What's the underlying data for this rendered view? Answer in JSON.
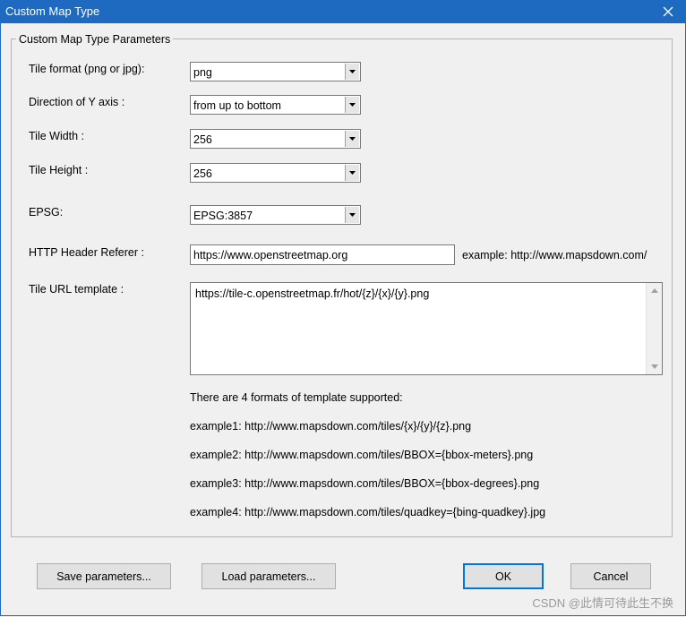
{
  "window": {
    "title": "Custom Map Type",
    "close_icon": "close-icon"
  },
  "group": {
    "legend": "Custom Map Type Parameters"
  },
  "fields": {
    "tile_format": {
      "label": "Tile format (png or jpg):",
      "value": "png"
    },
    "y_direction": {
      "label": "Direction of Y axis :",
      "value": "from up to bottom"
    },
    "tile_width": {
      "label": "Tile Width :",
      "value": "256"
    },
    "tile_height": {
      "label": "Tile Height :",
      "value": "256"
    },
    "epsg": {
      "label": "EPSG:",
      "value": "EPSG:3857"
    },
    "referer": {
      "label": "HTTP Header Referer :",
      "value": "https://www.openstreetmap.org",
      "example": "example: http://www.mapsdown.com/"
    },
    "url_template": {
      "label": "Tile URL template :",
      "value": "https://tile-c.openstreetmap.fr/hot/{z}/{x}/{y}.png"
    }
  },
  "info": {
    "intro": "There are 4 formats of template supported:",
    "example1": "example1: http://www.mapsdown.com/tiles/{x}/{y}/{z}.png",
    "example2": "example2: http://www.mapsdown.com/tiles/BBOX={bbox-meters}.png",
    "example3": "example3: http://www.mapsdown.com/tiles/BBOX={bbox-degrees}.png",
    "example4": "example4: http://www.mapsdown.com/tiles/quadkey={bing-quadkey}.jpg"
  },
  "buttons": {
    "save": "Save parameters...",
    "load": "Load parameters...",
    "ok": "OK",
    "cancel": "Cancel"
  },
  "watermark": "CSDN @此情可待此生不换",
  "colors": {
    "titlebar": "#1e6ac0",
    "dialog_bg": "#f0f0f0",
    "default_button_border": "#0078d7"
  }
}
